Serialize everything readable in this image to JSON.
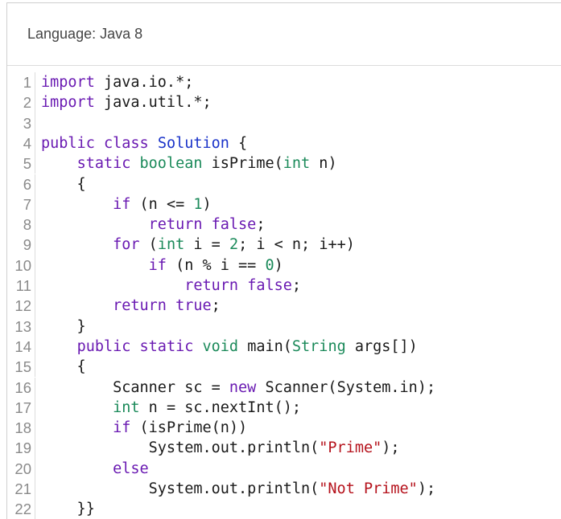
{
  "header": {
    "language_label": "Language: Java 8"
  },
  "editor": {
    "lines": [
      [
        [
          "kw",
          "import"
        ],
        [
          "pl",
          " java.io.*;"
        ]
      ],
      [
        [
          "kw",
          "import"
        ],
        [
          "pl",
          " java.util.*;"
        ]
      ],
      [],
      [
        [
          "kw",
          "public"
        ],
        [
          "pl",
          " "
        ],
        [
          "kw",
          "class"
        ],
        [
          "pl",
          " "
        ],
        [
          "cls",
          "Solution"
        ],
        [
          "pl",
          " {"
        ]
      ],
      [
        [
          "pl",
          "    "
        ],
        [
          "kw",
          "static"
        ],
        [
          "pl",
          " "
        ],
        [
          "ty",
          "boolean"
        ],
        [
          "pl",
          " isPrime("
        ],
        [
          "ty",
          "int"
        ],
        [
          "pl",
          " n)"
        ]
      ],
      [
        [
          "pl",
          "    {"
        ]
      ],
      [
        [
          "pl",
          "        "
        ],
        [
          "kw",
          "if"
        ],
        [
          "pl",
          " (n <= "
        ],
        [
          "num",
          "1"
        ],
        [
          "pl",
          ")"
        ]
      ],
      [
        [
          "pl",
          "            "
        ],
        [
          "kw",
          "return"
        ],
        [
          "pl",
          " "
        ],
        [
          "kw",
          "false"
        ],
        [
          "pl",
          ";"
        ]
      ],
      [
        [
          "pl",
          "        "
        ],
        [
          "kw",
          "for"
        ],
        [
          "pl",
          " ("
        ],
        [
          "ty",
          "int"
        ],
        [
          "pl",
          " i = "
        ],
        [
          "num",
          "2"
        ],
        [
          "pl",
          "; i < n; i++)"
        ]
      ],
      [
        [
          "pl",
          "            "
        ],
        [
          "kw",
          "if"
        ],
        [
          "pl",
          " (n % i == "
        ],
        [
          "num",
          "0"
        ],
        [
          "pl",
          ")"
        ]
      ],
      [
        [
          "pl",
          "                "
        ],
        [
          "kw",
          "return"
        ],
        [
          "pl",
          " "
        ],
        [
          "kw",
          "false"
        ],
        [
          "pl",
          ";"
        ]
      ],
      [
        [
          "pl",
          "        "
        ],
        [
          "kw",
          "return"
        ],
        [
          "pl",
          " "
        ],
        [
          "kw",
          "true"
        ],
        [
          "pl",
          ";"
        ]
      ],
      [
        [
          "pl",
          "    }"
        ]
      ],
      [
        [
          "pl",
          "    "
        ],
        [
          "kw",
          "public"
        ],
        [
          "pl",
          " "
        ],
        [
          "kw",
          "static"
        ],
        [
          "pl",
          " "
        ],
        [
          "ty",
          "void"
        ],
        [
          "pl",
          " main("
        ],
        [
          "ty",
          "String"
        ],
        [
          "pl",
          " args[])"
        ]
      ],
      [
        [
          "pl",
          "    {"
        ]
      ],
      [
        [
          "pl",
          "        Scanner sc = "
        ],
        [
          "kw",
          "new"
        ],
        [
          "pl",
          " Scanner(System.in);"
        ]
      ],
      [
        [
          "pl",
          "        "
        ],
        [
          "ty",
          "int"
        ],
        [
          "pl",
          " n = sc.nextInt();"
        ]
      ],
      [
        [
          "pl",
          "        "
        ],
        [
          "kw",
          "if"
        ],
        [
          "pl",
          " (isPrime(n))"
        ]
      ],
      [
        [
          "pl",
          "            System.out.println("
        ],
        [
          "str",
          "\"Prime\""
        ],
        [
          "pl",
          ");"
        ]
      ],
      [
        [
          "pl",
          "        "
        ],
        [
          "kw",
          "else"
        ]
      ],
      [
        [
          "pl",
          "            System.out.println("
        ],
        [
          "str",
          "\"Not Prime\""
        ],
        [
          "pl",
          ");"
        ]
      ],
      [
        [
          "pl",
          "    }}"
        ]
      ]
    ]
  }
}
